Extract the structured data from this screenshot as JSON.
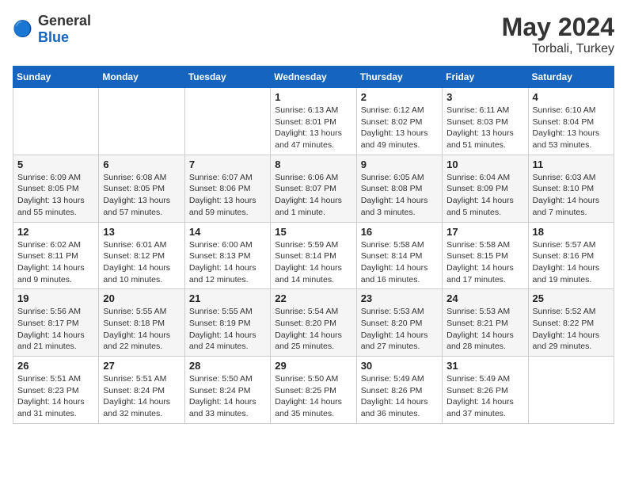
{
  "header": {
    "logo_general": "General",
    "logo_blue": "Blue",
    "title": "May 2024",
    "location": "Torbali, Turkey"
  },
  "weekdays": [
    "Sunday",
    "Monday",
    "Tuesday",
    "Wednesday",
    "Thursday",
    "Friday",
    "Saturday"
  ],
  "weeks": [
    [
      {
        "day": "",
        "info": ""
      },
      {
        "day": "",
        "info": ""
      },
      {
        "day": "",
        "info": ""
      },
      {
        "day": "1",
        "info": "Sunrise: 6:13 AM\nSunset: 8:01 PM\nDaylight: 13 hours\nand 47 minutes."
      },
      {
        "day": "2",
        "info": "Sunrise: 6:12 AM\nSunset: 8:02 PM\nDaylight: 13 hours\nand 49 minutes."
      },
      {
        "day": "3",
        "info": "Sunrise: 6:11 AM\nSunset: 8:03 PM\nDaylight: 13 hours\nand 51 minutes."
      },
      {
        "day": "4",
        "info": "Sunrise: 6:10 AM\nSunset: 8:04 PM\nDaylight: 13 hours\nand 53 minutes."
      }
    ],
    [
      {
        "day": "5",
        "info": "Sunrise: 6:09 AM\nSunset: 8:05 PM\nDaylight: 13 hours\nand 55 minutes."
      },
      {
        "day": "6",
        "info": "Sunrise: 6:08 AM\nSunset: 8:05 PM\nDaylight: 13 hours\nand 57 minutes."
      },
      {
        "day": "7",
        "info": "Sunrise: 6:07 AM\nSunset: 8:06 PM\nDaylight: 13 hours\nand 59 minutes."
      },
      {
        "day": "8",
        "info": "Sunrise: 6:06 AM\nSunset: 8:07 PM\nDaylight: 14 hours\nand 1 minute."
      },
      {
        "day": "9",
        "info": "Sunrise: 6:05 AM\nSunset: 8:08 PM\nDaylight: 14 hours\nand 3 minutes."
      },
      {
        "day": "10",
        "info": "Sunrise: 6:04 AM\nSunset: 8:09 PM\nDaylight: 14 hours\nand 5 minutes."
      },
      {
        "day": "11",
        "info": "Sunrise: 6:03 AM\nSunset: 8:10 PM\nDaylight: 14 hours\nand 7 minutes."
      }
    ],
    [
      {
        "day": "12",
        "info": "Sunrise: 6:02 AM\nSunset: 8:11 PM\nDaylight: 14 hours\nand 9 minutes."
      },
      {
        "day": "13",
        "info": "Sunrise: 6:01 AM\nSunset: 8:12 PM\nDaylight: 14 hours\nand 10 minutes."
      },
      {
        "day": "14",
        "info": "Sunrise: 6:00 AM\nSunset: 8:13 PM\nDaylight: 14 hours\nand 12 minutes."
      },
      {
        "day": "15",
        "info": "Sunrise: 5:59 AM\nSunset: 8:14 PM\nDaylight: 14 hours\nand 14 minutes."
      },
      {
        "day": "16",
        "info": "Sunrise: 5:58 AM\nSunset: 8:14 PM\nDaylight: 14 hours\nand 16 minutes."
      },
      {
        "day": "17",
        "info": "Sunrise: 5:58 AM\nSunset: 8:15 PM\nDaylight: 14 hours\nand 17 minutes."
      },
      {
        "day": "18",
        "info": "Sunrise: 5:57 AM\nSunset: 8:16 PM\nDaylight: 14 hours\nand 19 minutes."
      }
    ],
    [
      {
        "day": "19",
        "info": "Sunrise: 5:56 AM\nSunset: 8:17 PM\nDaylight: 14 hours\nand 21 minutes."
      },
      {
        "day": "20",
        "info": "Sunrise: 5:55 AM\nSunset: 8:18 PM\nDaylight: 14 hours\nand 22 minutes."
      },
      {
        "day": "21",
        "info": "Sunrise: 5:55 AM\nSunset: 8:19 PM\nDaylight: 14 hours\nand 24 minutes."
      },
      {
        "day": "22",
        "info": "Sunrise: 5:54 AM\nSunset: 8:20 PM\nDaylight: 14 hours\nand 25 minutes."
      },
      {
        "day": "23",
        "info": "Sunrise: 5:53 AM\nSunset: 8:20 PM\nDaylight: 14 hours\nand 27 minutes."
      },
      {
        "day": "24",
        "info": "Sunrise: 5:53 AM\nSunset: 8:21 PM\nDaylight: 14 hours\nand 28 minutes."
      },
      {
        "day": "25",
        "info": "Sunrise: 5:52 AM\nSunset: 8:22 PM\nDaylight: 14 hours\nand 29 minutes."
      }
    ],
    [
      {
        "day": "26",
        "info": "Sunrise: 5:51 AM\nSunset: 8:23 PM\nDaylight: 14 hours\nand 31 minutes."
      },
      {
        "day": "27",
        "info": "Sunrise: 5:51 AM\nSunset: 8:24 PM\nDaylight: 14 hours\nand 32 minutes."
      },
      {
        "day": "28",
        "info": "Sunrise: 5:50 AM\nSunset: 8:24 PM\nDaylight: 14 hours\nand 33 minutes."
      },
      {
        "day": "29",
        "info": "Sunrise: 5:50 AM\nSunset: 8:25 PM\nDaylight: 14 hours\nand 35 minutes."
      },
      {
        "day": "30",
        "info": "Sunrise: 5:49 AM\nSunset: 8:26 PM\nDaylight: 14 hours\nand 36 minutes."
      },
      {
        "day": "31",
        "info": "Sunrise: 5:49 AM\nSunset: 8:26 PM\nDaylight: 14 hours\nand 37 minutes."
      },
      {
        "day": "",
        "info": ""
      }
    ]
  ]
}
